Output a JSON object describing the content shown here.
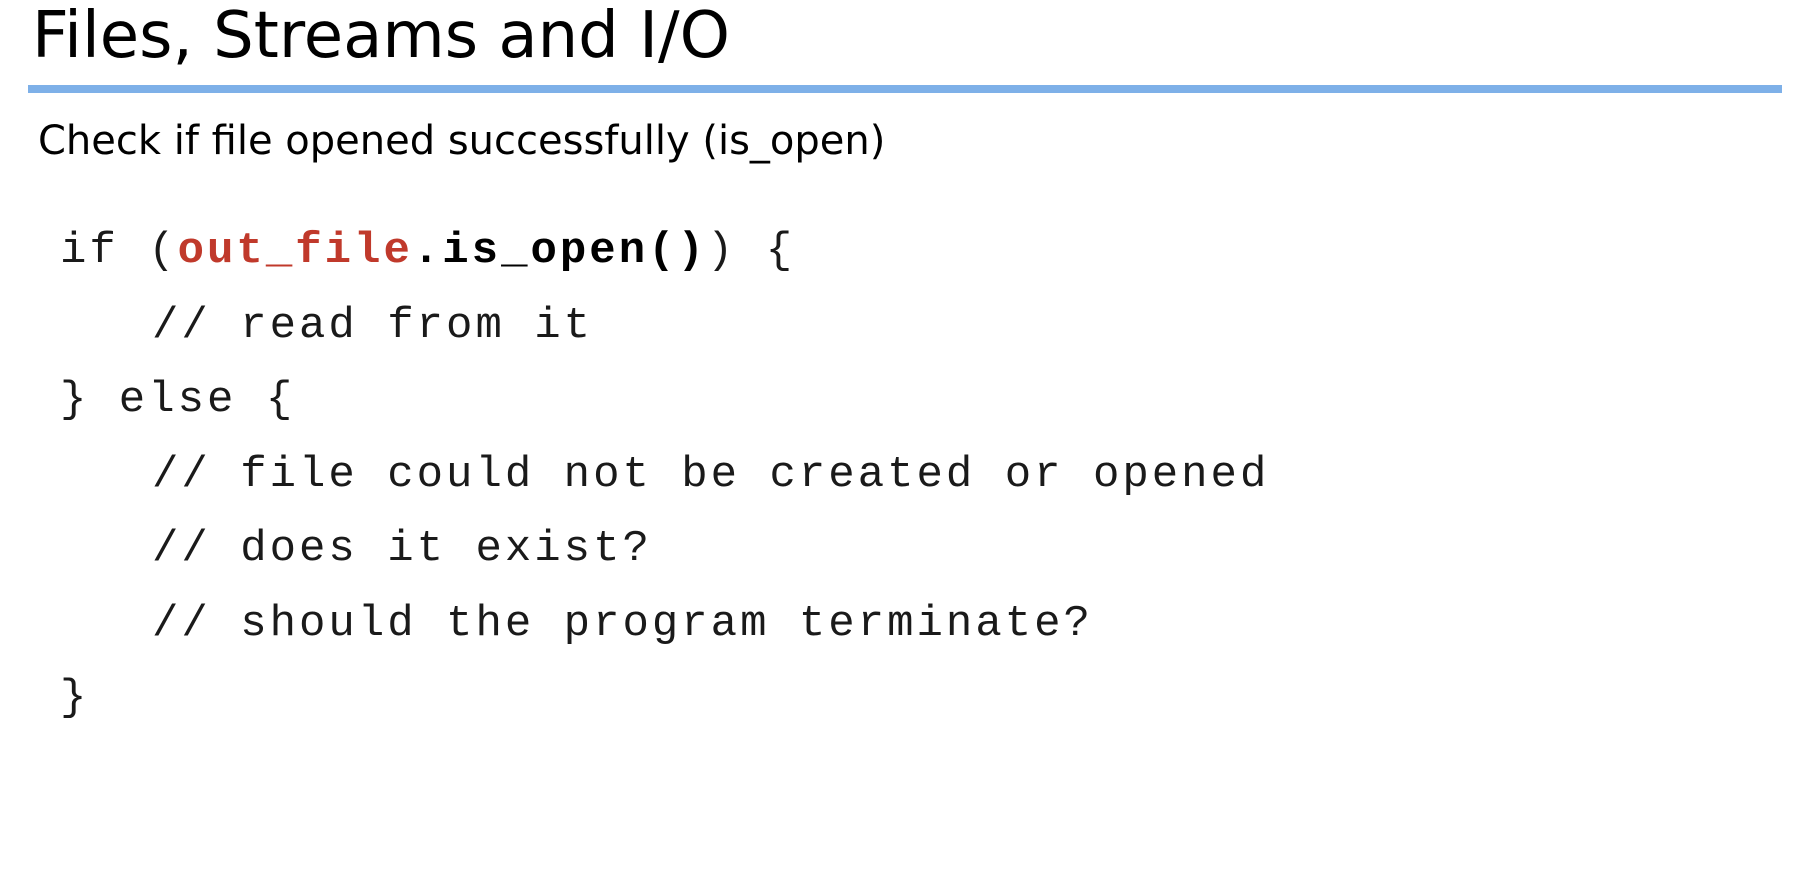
{
  "slide": {
    "title": "Files, Streams and I/O",
    "subtitle": "Check if file opened successfully (is_open)",
    "accent_color": "#7eb0e8",
    "highlight_color": "#c0392b"
  },
  "code": {
    "line1": {
      "keyword": "if (",
      "object": "out_file",
      "method": ".is_open()",
      "tail": ") {"
    },
    "line2": "// read from it",
    "line3": "} else {",
    "line4": "// file could not be created or opened",
    "line5": "// does it exist?",
    "line6": "// should the program terminate?",
    "line7": "}"
  }
}
